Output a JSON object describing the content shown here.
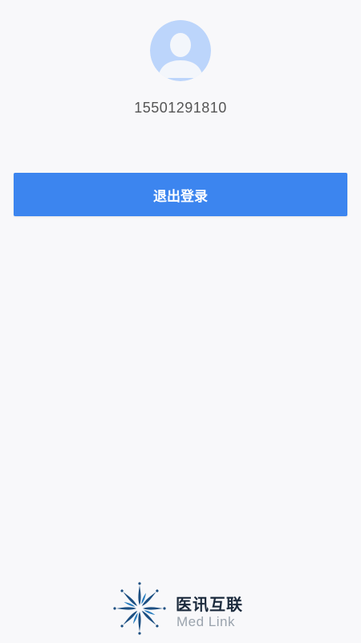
{
  "profile": {
    "avatar_icon": "user-avatar-placeholder-icon",
    "phone": "15501291810"
  },
  "actions": {
    "logout_label": "退出登录"
  },
  "brand": {
    "logo_icon": "starburst-logo-icon",
    "name_cn": "医讯互联",
    "name_en": "Med Link"
  },
  "colors": {
    "background": "#f8f8fa",
    "primary_button": "#3c85ef",
    "avatar_bg": "#bcd5fb",
    "brand_dark": "#1b2a3c",
    "brand_light": "#9aa3ad"
  }
}
